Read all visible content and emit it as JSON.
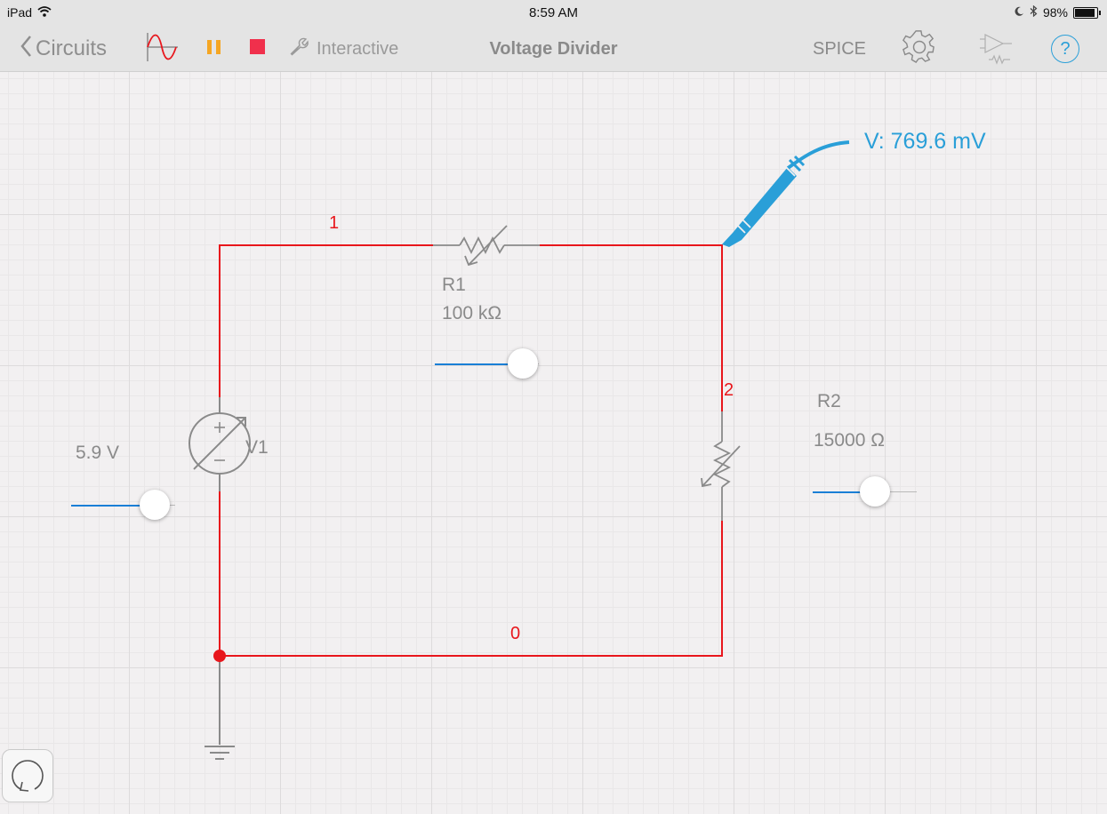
{
  "status_bar": {
    "device": "iPad",
    "time": "8:59 AM",
    "battery": "98%"
  },
  "toolbar": {
    "back_label": "Circuits",
    "mode_label": "Interactive",
    "title": "Voltage Divider",
    "spice_label": "SPICE",
    "help_label": "?"
  },
  "circuit": {
    "nodes": {
      "n1": "1",
      "n2": "2",
      "n0": "0"
    },
    "r1": {
      "name": "R1",
      "value": "100 kΩ",
      "slider_level": 0.85
    },
    "r2": {
      "name": "R2",
      "value": "15000 Ω",
      "slider_level": 0.6
    },
    "v1": {
      "name": "V1",
      "value": "5.9 V",
      "slider_level": 0.8
    },
    "probe": {
      "reading": "V: 769.6 mV"
    }
  },
  "colors": {
    "wire": "#e8161c",
    "probe": "#2a9fd8",
    "component": "#8a8a8a",
    "slider_active": "#1a7fd6",
    "pause": "#f5a623",
    "stop": "#f0304c"
  }
}
